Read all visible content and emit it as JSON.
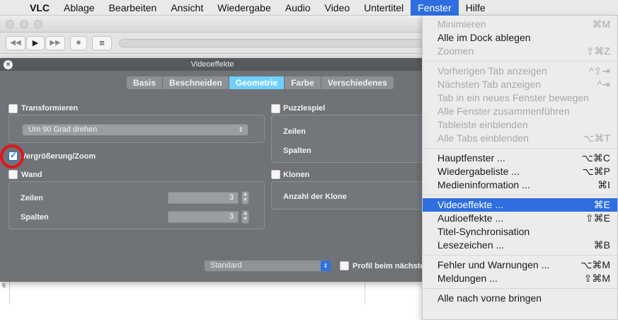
{
  "menubar": {
    "apple": "",
    "items": [
      "VLC",
      "Ablage",
      "Bearbeiten",
      "Ansicht",
      "Wiedergabe",
      "Audio",
      "Video",
      "Untertitel",
      "Fenster",
      "Hilfe"
    ]
  },
  "toolbar": {
    "rewind": "◀◀",
    "play": "▶",
    "forward": "▶▶",
    "stop": "■",
    "playlist": "≡"
  },
  "ruler": {
    "mark": "6"
  },
  "effects": {
    "title": "Videoeffekte",
    "close": "×",
    "tabs": [
      "Basis",
      "Beschneiden",
      "Geometrie",
      "Farbe",
      "Verschiedenes"
    ],
    "selected_tab": "Geometrie",
    "transform": {
      "label": "Transformieren",
      "checked": false,
      "select_value": "Um 90 Grad drehen"
    },
    "zoom": {
      "label": "Vergrößerung/Zoom",
      "checked": true
    },
    "wall": {
      "label": "Wand",
      "checked": false,
      "rows_label": "Zeilen",
      "rows_value": "3",
      "cols_label": "Spalten",
      "cols_value": "3"
    },
    "puzzle": {
      "label": "Puzzlespiel",
      "checked": false,
      "rows_label": "Zeilen",
      "cols_label": "Spalten"
    },
    "clone": {
      "label": "Klonen",
      "checked": false,
      "count_label": "Anzahl der Klone"
    },
    "profile": {
      "select_value": "Standard",
      "checkbox_label": "Profil beim nächste"
    }
  },
  "fenster_menu": {
    "groups": [
      [
        {
          "label": "Minimieren",
          "shortcut": "⌘M",
          "enabled": false
        },
        {
          "label": "Alle im Dock ablegen",
          "shortcut": "",
          "enabled": true
        },
        {
          "label": "Zoomen",
          "shortcut": "⇧⌘Z",
          "enabled": false
        }
      ],
      [
        {
          "label": "Vorherigen Tab anzeigen",
          "shortcut": "^⇧⇥",
          "enabled": false
        },
        {
          "label": "Nächsten Tab anzeigen",
          "shortcut": "^⇥",
          "enabled": false
        },
        {
          "label": "Tab in ein neues Fenster bewegen",
          "shortcut": "",
          "enabled": false
        },
        {
          "label": "Alle Fenster zusammenführen",
          "shortcut": "",
          "enabled": false
        },
        {
          "label": "Tableiste einblenden",
          "shortcut": "",
          "enabled": false
        },
        {
          "label": "Alle Tabs einblenden",
          "shortcut": "⌥⌘T",
          "enabled": false
        }
      ],
      [
        {
          "label": "Hauptfenster ...",
          "shortcut": "⌥⌘C",
          "enabled": true
        },
        {
          "label": "Wiedergabeliste ...",
          "shortcut": "⌥⌘P",
          "enabled": true
        },
        {
          "label": "Medieninformation ...",
          "shortcut": "⌘I",
          "enabled": true
        }
      ],
      [
        {
          "label": "Videoeffekte ...",
          "shortcut": "⌘E",
          "enabled": true,
          "highlighted": true
        },
        {
          "label": "Audioeffekte ...",
          "shortcut": "⇧⌘E",
          "enabled": true
        },
        {
          "label": "Titel-Synchronisation",
          "shortcut": "",
          "enabled": true
        },
        {
          "label": "Lesezeichen ...",
          "shortcut": "⌘B",
          "enabled": true
        }
      ],
      [
        {
          "label": "Fehler und Warnungen ...",
          "shortcut": "⌥⌘M",
          "enabled": true
        },
        {
          "label": "Meldungen ...",
          "shortcut": "⇧⌘M",
          "enabled": true
        }
      ],
      [
        {
          "label": "Alle nach vorne bringen",
          "shortcut": "",
          "enabled": true
        }
      ]
    ]
  },
  "colors": {
    "menu_highlight": "#2e6ee0",
    "selected_tab": "#6fd0ff",
    "annotation_circle": "#e2141a"
  }
}
